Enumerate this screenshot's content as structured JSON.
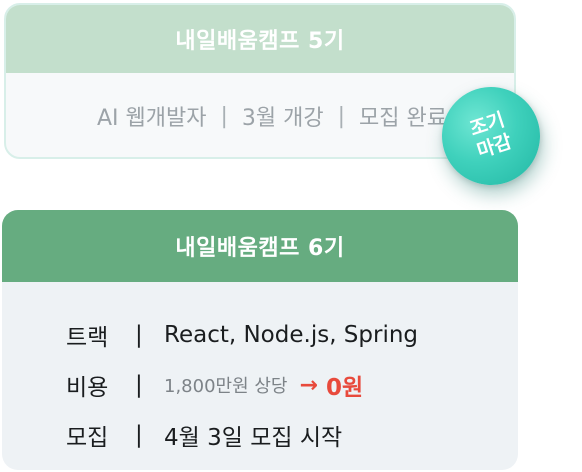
{
  "old_card": {
    "title": "내일배움캠프 5기",
    "track": "AI 웹개발자",
    "separator": "|",
    "start": "3월 개강",
    "status": "모집 완료"
  },
  "badge": {
    "line1": "조기",
    "line2": "마감"
  },
  "new_card": {
    "title": "내일배움캠프 6기",
    "separator": "|",
    "rows": [
      {
        "label": "트랙",
        "value": "React, Node.js, Spring"
      },
      {
        "label": "비용",
        "old_price": "1,800만원 상당",
        "arrow": "→",
        "new_price": "0원"
      },
      {
        "label": "모집",
        "value": "4월 3일 모집 시작"
      }
    ]
  },
  "colors": {
    "old_header": "#c3dfcc",
    "new_header": "#66ac80",
    "badge": "#3fd1bc",
    "highlight": "#e84a3c"
  }
}
